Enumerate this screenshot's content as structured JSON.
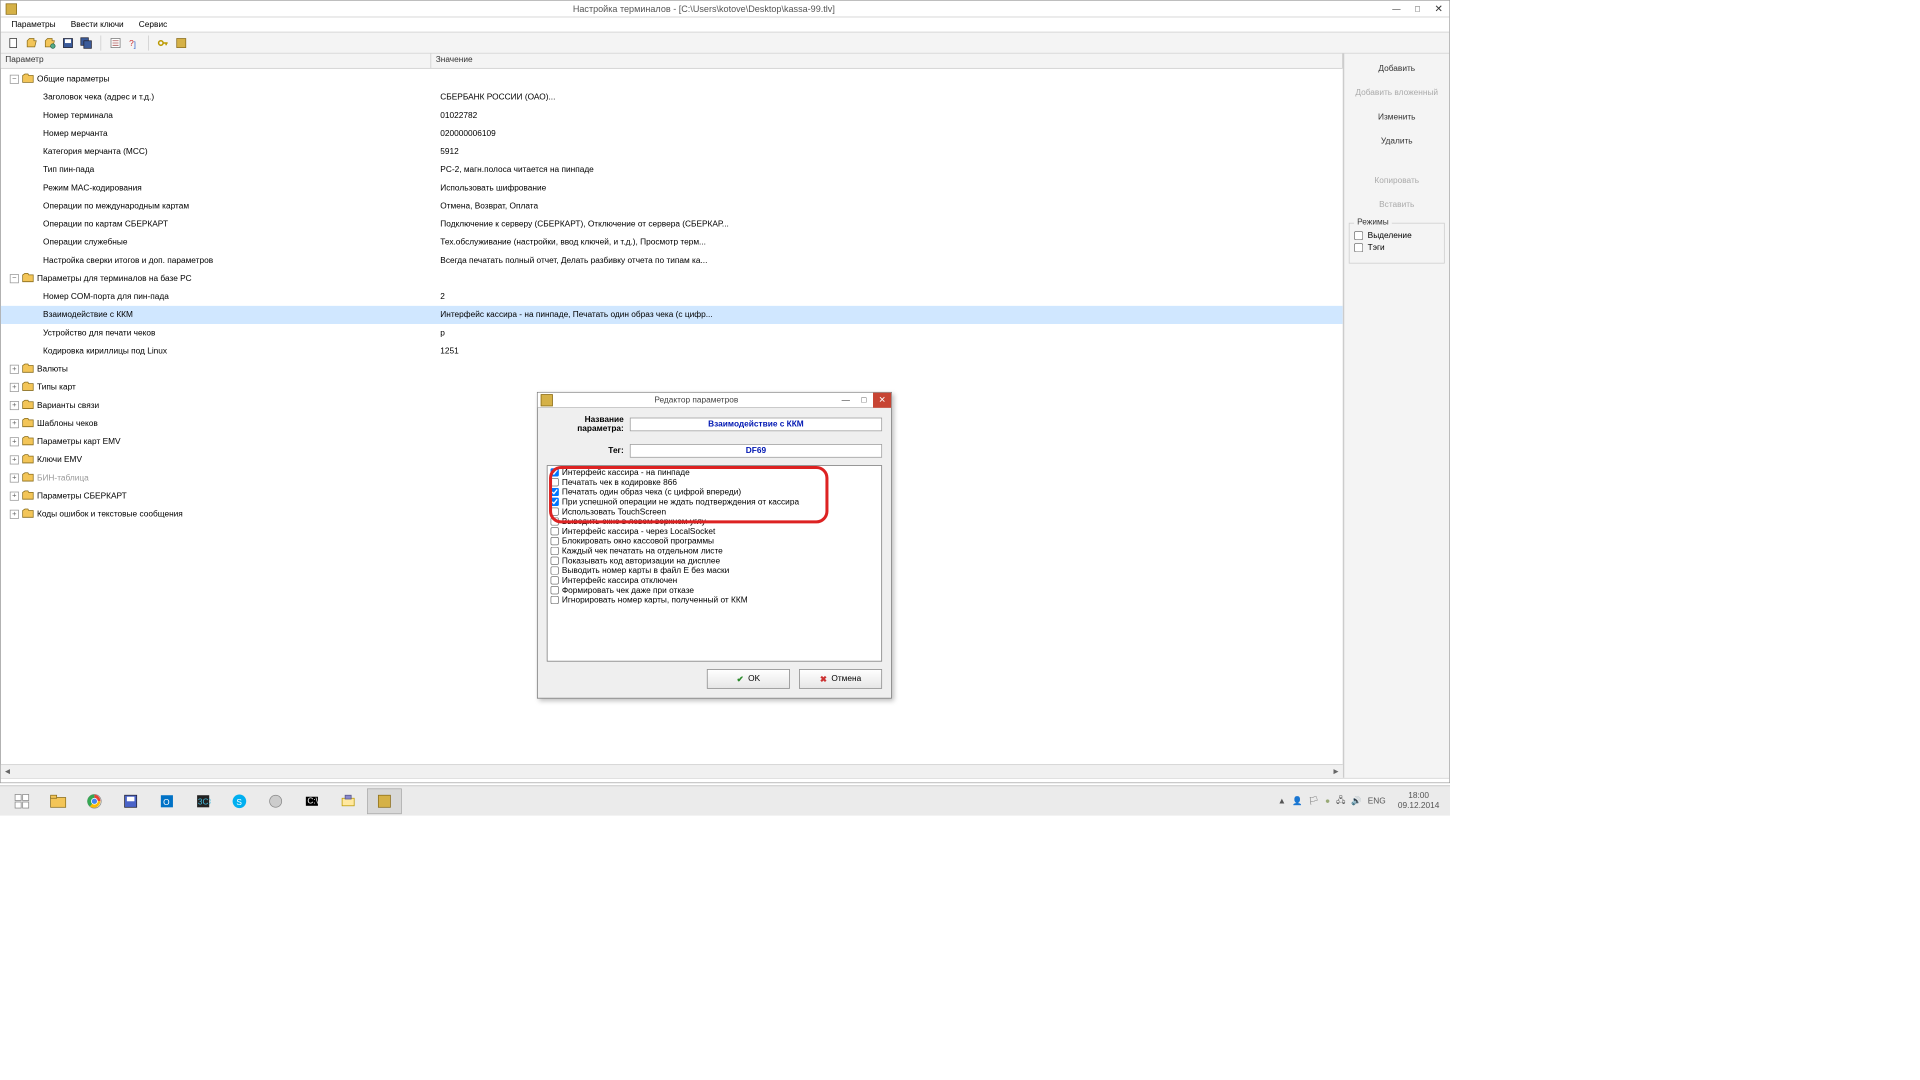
{
  "window": {
    "title": "Настройка терминалов - [C:\\Users\\kotove\\Desktop\\kassa-99.tlv]"
  },
  "menu": {
    "items": [
      "Параметры",
      "Ввести ключи",
      "Сервис"
    ]
  },
  "toolbar_icons": [
    "new",
    "open",
    "open2",
    "save",
    "saveall",
    "sep",
    "props",
    "help",
    "sep",
    "key",
    "opts"
  ],
  "grid": {
    "col_param": "Параметр",
    "col_value": "Значение",
    "rows": [
      {
        "d": 0,
        "exp": "-",
        "folder": true,
        "p": "Общие параметры",
        "v": ""
      },
      {
        "d": 1,
        "p": "Заголовок чека (адрес и т.д.)",
        "v": "СБЕРБАНК РОССИИ (ОАО)..."
      },
      {
        "d": 1,
        "p": "Номер терминала",
        "v": "01022782"
      },
      {
        "d": 1,
        "p": "Номер мерчанта",
        "v": "020000006109"
      },
      {
        "d": 1,
        "p": "Категория мерчанта (MCC)",
        "v": "5912"
      },
      {
        "d": 1,
        "p": "Тип пин-пада",
        "v": "PC-2, магн.полоса читается на пинпаде"
      },
      {
        "d": 1,
        "p": "Режим MAC-кодирования",
        "v": "Использовать шифрование"
      },
      {
        "d": 1,
        "p": "Операции по международным картам",
        "v": "Отмена, Возврат, Оплата"
      },
      {
        "d": 1,
        "p": "Операции по картам СБЕРКАРТ",
        "v": "Подключение к серверу (СБЕРКАРТ), Отключение от сервера (СБЕРКАР..."
      },
      {
        "d": 1,
        "p": "Операции служебные",
        "v": "Тех.обслуживание (настройки, ввод ключей, и т.д.), Просмотр терм..."
      },
      {
        "d": 1,
        "p": "Настройка сверки итогов и доп. параметров",
        "v": "Всегда печатать полный отчет, Делать разбивку отчета по типам ка..."
      },
      {
        "d": 0,
        "exp": "-",
        "folder": true,
        "p": "Параметры для терминалов на базе PC",
        "v": ""
      },
      {
        "d": 1,
        "p": "Номер COM-порта для пин-пада",
        "v": "2"
      },
      {
        "d": 1,
        "sel": true,
        "p": "Взаимодействие с ККМ",
        "v": "Интерфейс кассира - на пинпаде, Печатать один образ чека (с цифр..."
      },
      {
        "d": 1,
        "p": "Устройство для печати чеков",
        "v": "p"
      },
      {
        "d": 1,
        "p": "Кодировка кириллицы под Linux",
        "v": "1251"
      },
      {
        "d": 0,
        "exp": "+",
        "folder": true,
        "p": "Валюты",
        "v": ""
      },
      {
        "d": 0,
        "exp": "+",
        "folder": true,
        "p": "Типы карт",
        "v": ""
      },
      {
        "d": 0,
        "exp": "+",
        "folder": true,
        "p": "Варианты связи",
        "v": ""
      },
      {
        "d": 0,
        "exp": "+",
        "folder": true,
        "p": "Шаблоны чеков",
        "v": ""
      },
      {
        "d": 0,
        "exp": "+",
        "folder": true,
        "p": "Параметры карт EMV",
        "v": ""
      },
      {
        "d": 0,
        "exp": "+",
        "folder": true,
        "p": "Ключи EMV",
        "v": ""
      },
      {
        "d": 0,
        "exp": "+",
        "folder": true,
        "gray": true,
        "p": "БИН-таблица",
        "v": ""
      },
      {
        "d": 0,
        "exp": "+",
        "folder": true,
        "p": "Параметры СБЕРКАРТ",
        "v": ""
      },
      {
        "d": 0,
        "exp": "+",
        "folder": true,
        "p": "Коды ошибок и текстовые сообщения",
        "v": ""
      }
    ]
  },
  "sidepanel": {
    "buttons": [
      {
        "label": "Добавить",
        "dis": false
      },
      {
        "label": "Добавить вложенный",
        "dis": true
      },
      {
        "label": "Изменить",
        "dis": false
      },
      {
        "label": "Удалить",
        "dis": false
      },
      {
        "label": "Копировать",
        "dis": true
      },
      {
        "label": "Вставить",
        "dis": true
      }
    ],
    "reg_title": "Режимы",
    "reg_items": [
      "Выделение",
      "Тэги"
    ]
  },
  "modal": {
    "title": "Редактор параметров",
    "name_label": "Название параметра:",
    "name_value": "Взаимодействие с ККМ",
    "tag_label": "Тег:",
    "tag_value": "DF69",
    "items": [
      {
        "c": true,
        "t": "Интерфейс кассира - на пинпаде"
      },
      {
        "c": false,
        "t": "Печатать чек в кодировке 866"
      },
      {
        "c": true,
        "t": "Печатать один образ чека (с цифрой впереди)"
      },
      {
        "c": true,
        "t": "При успешной операции не ждать подтверждения от кассира"
      },
      {
        "c": false,
        "t": "Использовать TouchScreen"
      },
      {
        "c": false,
        "t": "Выводить окно в левом верхнем углу"
      },
      {
        "c": false,
        "t": "Интерфейс кассира - через LocalSocket"
      },
      {
        "c": false,
        "t": "Блокировать окно кассовой программы"
      },
      {
        "c": false,
        "t": "Каждый чек печатать на отдельном листе"
      },
      {
        "c": false,
        "t": "Показывать код авторизации на дисплее"
      },
      {
        "c": false,
        "t": "Выводить номер карты в файл E без маски"
      },
      {
        "c": false,
        "t": "Интерфейс кассира отключен"
      },
      {
        "c": false,
        "t": "Формировать чек даже при отказе"
      },
      {
        "c": false,
        "t": "Игнорировать номер карты, полученный от ККМ"
      }
    ],
    "ok": "OK",
    "cancel": "Отмена"
  },
  "taskbar": {
    "lang": "ENG",
    "time": "18:00",
    "date": "09.12.2014"
  }
}
